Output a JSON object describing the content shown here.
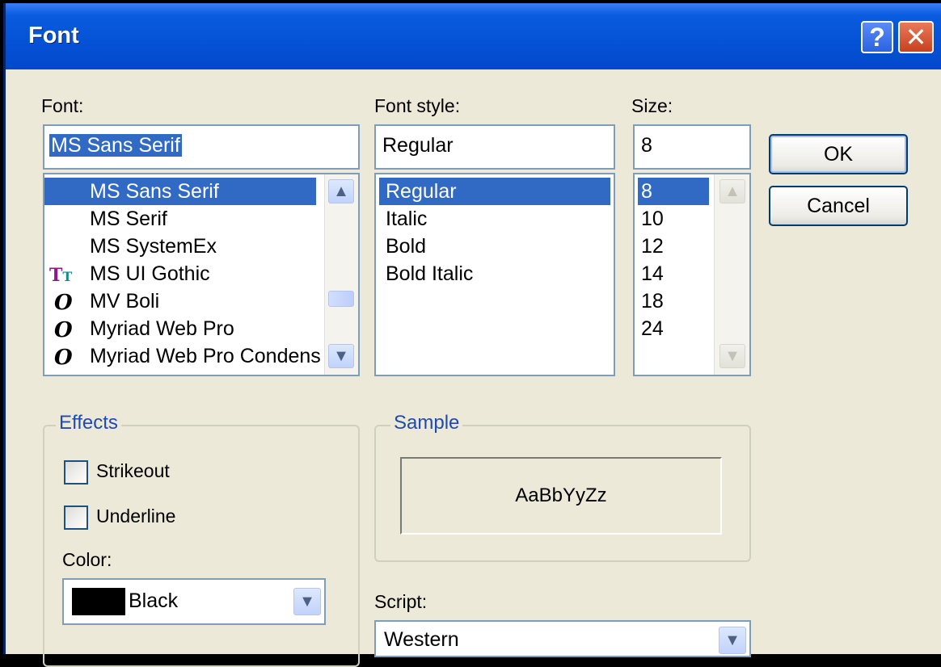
{
  "window": {
    "title": "Font",
    "help_label": "?",
    "close_label": "✕"
  },
  "font": {
    "label": "Font:",
    "value": "MS Sans Serif",
    "items": [
      {
        "label": "MS Sans Serif",
        "icon": "none",
        "selected": true
      },
      {
        "label": "MS Serif",
        "icon": "none"
      },
      {
        "label": "MS SystemEx",
        "icon": "none"
      },
      {
        "label": "MS UI Gothic",
        "icon": "truetype-icon"
      },
      {
        "label": "MV Boli",
        "icon": "opentype-icon"
      },
      {
        "label": "Myriad Web Pro",
        "icon": "opentype-icon"
      },
      {
        "label": "Myriad Web Pro Condensed",
        "icon": "opentype-icon"
      }
    ],
    "scroll_position": 0.45
  },
  "style": {
    "label": "Font style:",
    "value": "Regular",
    "items": [
      "Regular",
      "Italic",
      "Bold",
      "Bold Italic"
    ],
    "selected": "Regular"
  },
  "size": {
    "label": "Size:",
    "value": "8",
    "items": [
      "8",
      "10",
      "12",
      "14",
      "18",
      "24"
    ],
    "selected": "8"
  },
  "buttons": {
    "ok": "OK",
    "cancel": "Cancel"
  },
  "effects": {
    "legend": "Effects",
    "strikeout": "Strikeout",
    "underline": "Underline",
    "strikeout_checked": false,
    "underline_checked": false,
    "color_label": "Color:",
    "color_value": "Black",
    "color_swatch": "#000000"
  },
  "sample": {
    "legend": "Sample",
    "text": "AaBbYyZz"
  },
  "script": {
    "label": "Script:",
    "value": "Western"
  },
  "colors": {
    "title_bar": "#0654D8",
    "selection": "#316AC5",
    "dialog_bg": "#ECE9D8",
    "group_label": "#1E4AB4"
  }
}
